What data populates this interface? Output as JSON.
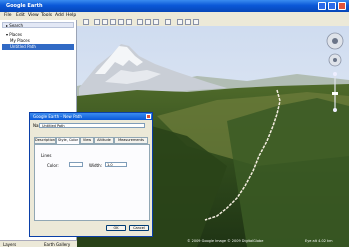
{
  "window": {
    "title": "Google Earth"
  },
  "menu": [
    "File",
    "Edit",
    "View",
    "Tools",
    "Add",
    "Help"
  ],
  "left_panel": {
    "search_label": "▸ Search",
    "places": [
      {
        "label": "▾ Places",
        "selected": false
      },
      {
        "label": "My Places",
        "selected": false
      },
      {
        "label": "Untitled Path",
        "selected": true
      }
    ],
    "footer_left": "Layers",
    "footer_right": "Earth Gallery"
  },
  "dialog": {
    "title": "Google Earth - New Path",
    "name_label": "Name:",
    "name_value": "Untitled Path",
    "tabs": [
      "Description",
      "Style, Color",
      "View",
      "Altitude",
      "Measurements"
    ],
    "active_tab": 1,
    "lines_label": "Lines",
    "color_label": "Color:",
    "width_label": "Width:",
    "width_value": "1.0",
    "ok_label": "OK",
    "cancel_label": "Cancel"
  },
  "status": {
    "copyright": "© 2009 Google  Image © 2009 DigitalGlobe",
    "coords": "Eye alt 4.02 km"
  },
  "colors": {
    "accent": "#0a58d8",
    "path": "#f4ede0"
  }
}
